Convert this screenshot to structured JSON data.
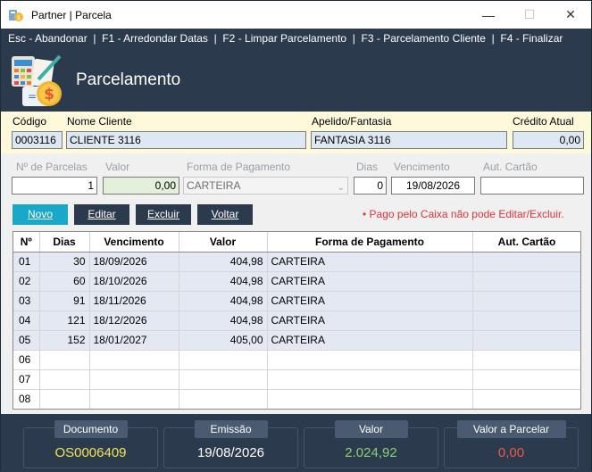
{
  "window": {
    "title": "Partner | Parcela",
    "minimize": "—",
    "maximize": "☐",
    "close": "✕"
  },
  "shortcuts": "Esc - Abandonar  |  F1 - Arredondar Datas  |  F2 - Limpar Parcelamento  |  F3 - Parcelamento Cliente  |  F4 - Finalizar",
  "header": {
    "title": "Parcelamento",
    "logo_icon": "calculator-money-icon",
    "logo_coin": "$"
  },
  "client": {
    "codigo_label": "Código",
    "codigo_value": "0003116",
    "nome_label": "Nome Cliente",
    "nome_value": "CLIENTE 3116",
    "apelido_label": "Apelido/Fantasia",
    "apelido_value": "FANTASIA 3116",
    "credito_label": "Crédito Atual",
    "credito_value": "0,00"
  },
  "form": {
    "parcelas_label": "Nº de Parcelas",
    "parcelas_value": "1",
    "valor_label": "Valor",
    "valor_value": "0,00",
    "forma_label": "Forma de Pagamento",
    "forma_value": "CARTEIRA",
    "dias_label": "Dias",
    "dias_value": "0",
    "vencimento_label": "Vencimento",
    "vencimento_value": "19/08/2026",
    "autcartao_label": "Aut. Cartão",
    "autcartao_value": ""
  },
  "buttons": {
    "novo": "Novo",
    "editar": "Editar",
    "excluir": "Excluir",
    "voltar": "Voltar"
  },
  "warning": "• Pago pelo Caixa não pode Editar/Excluir.",
  "grid": {
    "columns": [
      "Nº",
      "Dias",
      "Vencimento",
      "Valor",
      "Forma de Pagamento",
      "Aut. Cartão"
    ],
    "rows": [
      [
        "01",
        "30",
        "18/09/2026",
        "404,98",
        "CARTEIRA",
        ""
      ],
      [
        "02",
        "60",
        "18/10/2026",
        "404,98",
        "CARTEIRA",
        ""
      ],
      [
        "03",
        "91",
        "18/11/2026",
        "404,98",
        "CARTEIRA",
        ""
      ],
      [
        "04",
        "121",
        "18/12/2026",
        "404,98",
        "CARTEIRA",
        ""
      ],
      [
        "05",
        "152",
        "18/01/2027",
        "405,00",
        "CARTEIRA",
        ""
      ],
      [
        "06",
        "",
        "",
        "",
        "",
        ""
      ],
      [
        "07",
        "",
        "",
        "",
        "",
        ""
      ],
      [
        "08",
        "",
        "",
        "",
        "",
        ""
      ]
    ]
  },
  "summary": {
    "documento_label": "Documento",
    "documento_value": "OS0006409",
    "emissao_label": "Emissão",
    "emissao_value": "19/08/2026",
    "valor_label": "Valor",
    "valor_value": "2.024,92",
    "aparcelar_label": "Valor a Parcelar",
    "aparcelar_value": "0,00"
  },
  "colors": {
    "header_bg": "#2b3a4d",
    "client_panel_bg": "#fff9dc",
    "button_active": "#19a8c7",
    "warning": "#e0333a",
    "doc_value": "#f2e35a",
    "valor_value": "#8fcf7a",
    "aparcelar_value": "#e85c4a"
  }
}
